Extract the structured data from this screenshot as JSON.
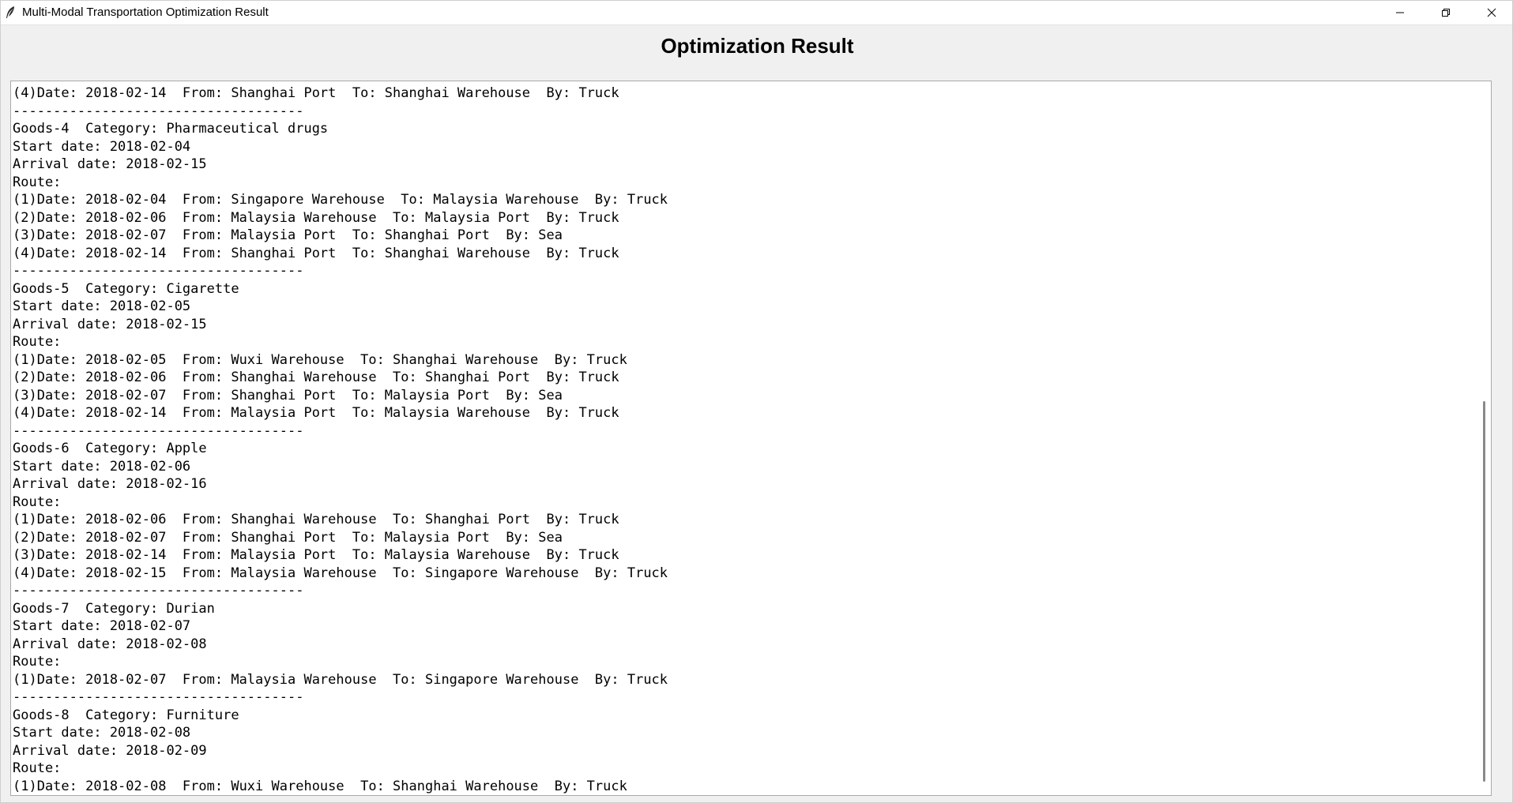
{
  "window": {
    "title": "Multi-Modal Transportation Optimization Result"
  },
  "heading": "Optimization Result",
  "output_lines": [
    "(4)Date: 2018-02-14  From: Shanghai Port  To: Shanghai Warehouse  By: Truck",
    "------------------------------------",
    "Goods-4  Category: Pharmaceutical drugs",
    "Start date: 2018-02-04",
    "Arrival date: 2018-02-15",
    "Route:",
    "(1)Date: 2018-02-04  From: Singapore Warehouse  To: Malaysia Warehouse  By: Truck",
    "(2)Date: 2018-02-06  From: Malaysia Warehouse  To: Malaysia Port  By: Truck",
    "(3)Date: 2018-02-07  From: Malaysia Port  To: Shanghai Port  By: Sea",
    "(4)Date: 2018-02-14  From: Shanghai Port  To: Shanghai Warehouse  By: Truck",
    "------------------------------------",
    "Goods-5  Category: Cigarette",
    "Start date: 2018-02-05",
    "Arrival date: 2018-02-15",
    "Route:",
    "(1)Date: 2018-02-05  From: Wuxi Warehouse  To: Shanghai Warehouse  By: Truck",
    "(2)Date: 2018-02-06  From: Shanghai Warehouse  To: Shanghai Port  By: Truck",
    "(3)Date: 2018-02-07  From: Shanghai Port  To: Malaysia Port  By: Sea",
    "(4)Date: 2018-02-14  From: Malaysia Port  To: Malaysia Warehouse  By: Truck",
    "------------------------------------",
    "Goods-6  Category: Apple",
    "Start date: 2018-02-06",
    "Arrival date: 2018-02-16",
    "Route:",
    "(1)Date: 2018-02-06  From: Shanghai Warehouse  To: Shanghai Port  By: Truck",
    "(2)Date: 2018-02-07  From: Shanghai Port  To: Malaysia Port  By: Sea",
    "(3)Date: 2018-02-14  From: Malaysia Port  To: Malaysia Warehouse  By: Truck",
    "(4)Date: 2018-02-15  From: Malaysia Warehouse  To: Singapore Warehouse  By: Truck",
    "------------------------------------",
    "Goods-7  Category: Durian",
    "Start date: 2018-02-07",
    "Arrival date: 2018-02-08",
    "Route:",
    "(1)Date: 2018-02-07  From: Malaysia Warehouse  To: Singapore Warehouse  By: Truck",
    "------------------------------------",
    "Goods-8  Category: Furniture",
    "Start date: 2018-02-08",
    "Arrival date: 2018-02-09",
    "Route:",
    "(1)Date: 2018-02-08  From: Wuxi Warehouse  To: Shanghai Warehouse  By: Truck"
  ],
  "scrollbar": {
    "position_fraction": 0.48
  },
  "icons": {
    "app": "feather-icon",
    "minimize": "minimize-icon",
    "maximize": "restore-icon",
    "close": "close-icon"
  }
}
